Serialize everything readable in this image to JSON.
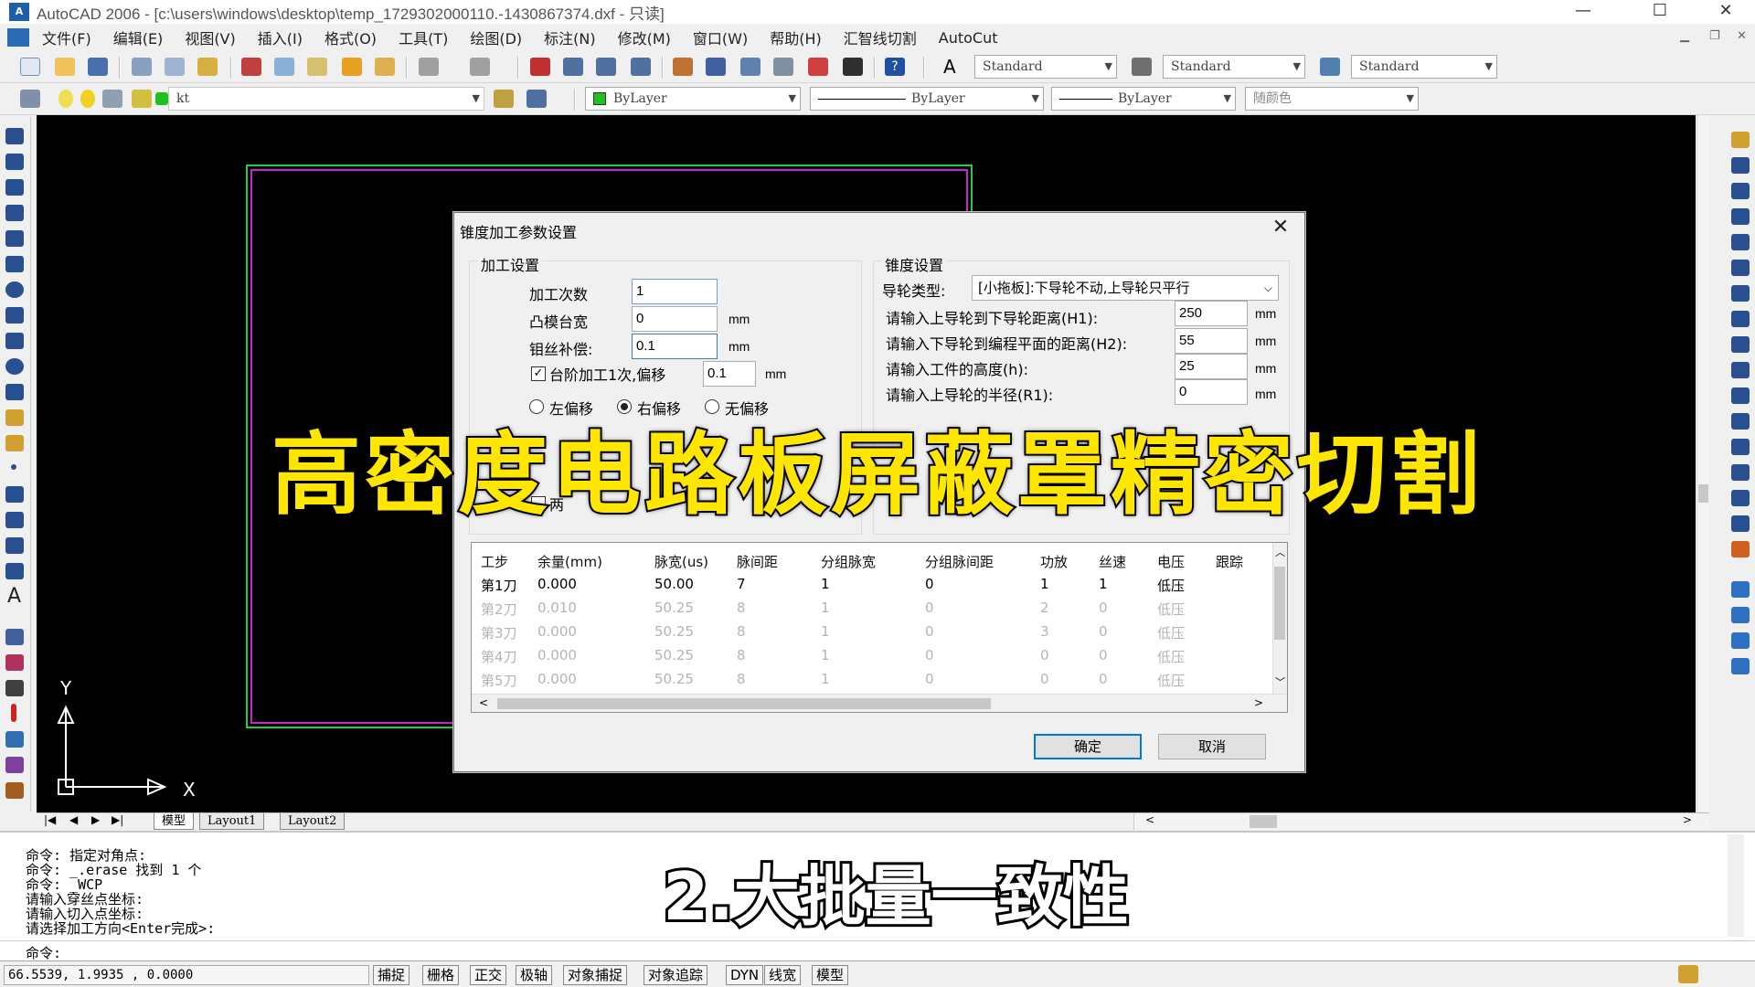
{
  "window": {
    "title": "AutoCAD 2006 - [c:\\users\\windows\\desktop\\temp_1729302000110.-1430867374.dxf - 只读]",
    "minimize": "—",
    "maximize": "☐",
    "close": "✕"
  },
  "menu": [
    "文件(F)",
    "编辑(E)",
    "视图(V)",
    "插入(I)",
    "格式(O)",
    "工具(T)",
    "绘图(D)",
    "标注(N)",
    "修改(M)",
    "窗口(W)",
    "帮助(H)",
    "汇智线切割",
    "AutoCut"
  ],
  "toolbar": {
    "text_style": "Standard",
    "dim_style": "Standard",
    "table_style": "Standard",
    "layer": "kt",
    "color": "ByLayer",
    "linetype": "ByLayer",
    "lineweight": "ByLayer",
    "plot_style": "随颜色"
  },
  "ucs": {
    "y": "Y",
    "x": "X"
  },
  "tabs": [
    "模型",
    "Layout1",
    "Layout2"
  ],
  "dialog": {
    "title": "锥度加工参数设置",
    "processing_group": "加工设置",
    "pass_count_label": "加工次数",
    "pass_count": "1",
    "punch_width_label": "凸模台宽",
    "punch_width": "0",
    "wire_comp_label": "钼丝补偿:",
    "wire_comp": "0.1",
    "unit": "mm",
    "step_offset_label": "台阶加工1次,偏移",
    "step_offset": "0.1",
    "offset_left": "左偏移",
    "offset_right": "右偏移",
    "offset_none": "无偏移",
    "both_label": "两",
    "taper_group": "锥度设置",
    "guide_type_label": "导轮类型:",
    "guide_type": "[小拖板]:下导轮不动,上导轮只平行",
    "h1_label": "请输入上导轮到下导轮距离(H1):",
    "h1": "250",
    "h2_label": "请输入下导轮到编程平面的距离(H2):",
    "h2": "55",
    "h_label": "请输入工件的高度(h):",
    "h": "25",
    "r1_label": "请输入上导轮的半径(R1):",
    "r1": "0",
    "ok": "确定",
    "cancel": "取消",
    "table": {
      "headers": [
        "工步",
        "余量(mm)",
        "脉宽(us)",
        "脉间距",
        "分组脉宽",
        "分组脉间距",
        "功放",
        "丝速",
        "电压",
        "跟踪"
      ],
      "rows": [
        [
          "第1刀",
          "0.000",
          "50.00",
          "7",
          "1",
          "0",
          "1",
          "1",
          "低压"
        ],
        [
          "第2刀",
          "0.010",
          "50.25",
          "8",
          "1",
          "0",
          "2",
          "0",
          "低压"
        ],
        [
          "第3刀",
          "0.000",
          "50.25",
          "8",
          "1",
          "0",
          "3",
          "0",
          "低压"
        ],
        [
          "第4刀",
          "0.000",
          "50.25",
          "8",
          "1",
          "0",
          "0",
          "0",
          "低压"
        ],
        [
          "第5刀",
          "0.000",
          "50.25",
          "8",
          "1",
          "0",
          "0",
          "0",
          "低压"
        ]
      ]
    }
  },
  "command_lines": [
    "命令: 指定对角点:",
    "命令: _.erase 找到 1 个",
    "命令: _WCP",
    "请输入穿丝点坐标:",
    "请输入切入点坐标:",
    "请选择加工方向<Enter完成>:",
    "命令:"
  ],
  "status": {
    "coords": "66.5539, 1.9935 , 0.0000",
    "buttons": [
      "捕捉",
      "栅格",
      "正交",
      "极轴",
      "对象捕捉",
      "对象追踪",
      "DYN",
      "线宽",
      "模型"
    ]
  },
  "overlay": {
    "title": "高密度电路板屏蔽罩精密切割",
    "subtitle": "2.大批量一致性"
  },
  "colors": {
    "drawing_bg": "#000000",
    "green_frame": "#22cc44",
    "magenta_frame": "#cc22cc",
    "overlay_yellow": "#ffe600",
    "accent_blue": "#0078d7"
  }
}
